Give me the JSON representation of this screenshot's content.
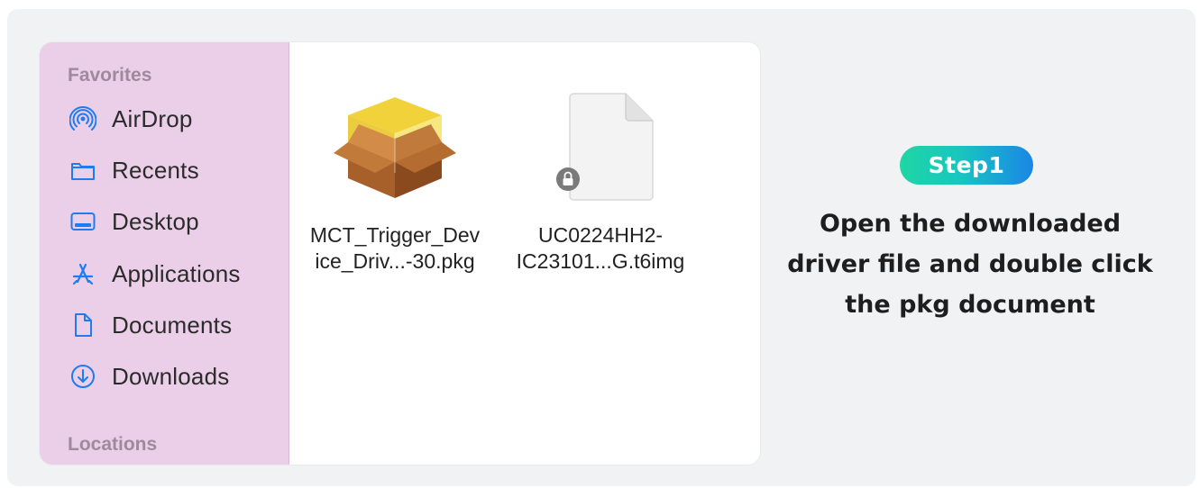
{
  "sidebar": {
    "favorites_label": "Favorites",
    "locations_label": "Locations",
    "items": [
      {
        "label": "AirDrop",
        "icon": "airdrop-icon"
      },
      {
        "label": "Recents",
        "icon": "folder-icon"
      },
      {
        "label": "Desktop",
        "icon": "desktop-icon"
      },
      {
        "label": "Applications",
        "icon": "applications-icon"
      },
      {
        "label": "Documents",
        "icon": "document-icon"
      },
      {
        "label": "Downloads",
        "icon": "download-icon"
      }
    ]
  },
  "files": [
    {
      "name_line1": "MCT_Trigger_Dev",
      "name_line2": "ice_Driv...-30.pkg",
      "icon": "package-icon"
    },
    {
      "name_line1": "UC0224HH2-",
      "name_line2": "IC23101...G.t6img",
      "icon": "locked-file-icon"
    }
  ],
  "step": {
    "badge": "Step1",
    "line1": "Open the downloaded",
    "line2": "driver file and double click",
    "line3": "the pkg document"
  },
  "colors": {
    "sidebar_bg": "#ebcfe8",
    "accent_blue": "#1f7cf0",
    "badge_gradient_start": "#1fd6a4",
    "badge_gradient_end": "#1a86e6"
  }
}
